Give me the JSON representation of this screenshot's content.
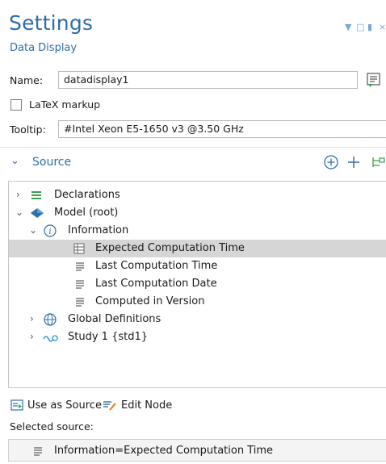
{
  "header": {
    "title": "Settings",
    "subtitle": "Data Display",
    "controls": [
      "dropdown-icon",
      "restore-icon",
      "pin-icon",
      "close-icon"
    ]
  },
  "form": {
    "name_label": "Name:",
    "name_value": "datadisplay1",
    "latex_label": "LaTeX markup",
    "latex_checked": false,
    "tooltip_label": "Tooltip:",
    "tooltip_value": "#Intel Xeon E5-1650 v3 @3.50 GHz"
  },
  "source": {
    "title": "Source",
    "actions": [
      "add-circle-icon",
      "add-icon",
      "tree-icon"
    ]
  },
  "tree": [
    {
      "label": "Declarations",
      "icon": "declarations-icon",
      "expanded": false,
      "selected": false
    },
    {
      "label": "Model (root)",
      "icon": "model-icon",
      "expanded": true,
      "selected": false
    },
    {
      "label": "Information",
      "icon": "info-icon",
      "expanded": true,
      "selected": false
    },
    {
      "label": "Expected Computation Time",
      "icon": "table-icon",
      "selected": true
    },
    {
      "label": "Last Computation Time",
      "icon": "list-icon",
      "selected": false
    },
    {
      "label": "Last Computation Date",
      "icon": "list-icon",
      "selected": false
    },
    {
      "label": "Computed in Version",
      "icon": "list-icon",
      "selected": false
    },
    {
      "label": "Global Definitions",
      "icon": "globe-icon",
      "expanded": false,
      "selected": false
    },
    {
      "label": "Study 1 {std1}",
      "icon": "study-icon",
      "expanded": false,
      "selected": false
    }
  ],
  "buttons": {
    "use_as_source": "Use as Source",
    "edit_node": "Edit Node"
  },
  "selected_source": {
    "label": "Selected source:",
    "value": "Information=Expected Computation Time"
  },
  "colors": {
    "accent": "#2f6eaa",
    "selection": "#d6d6d6",
    "green": "#3aa14b"
  }
}
